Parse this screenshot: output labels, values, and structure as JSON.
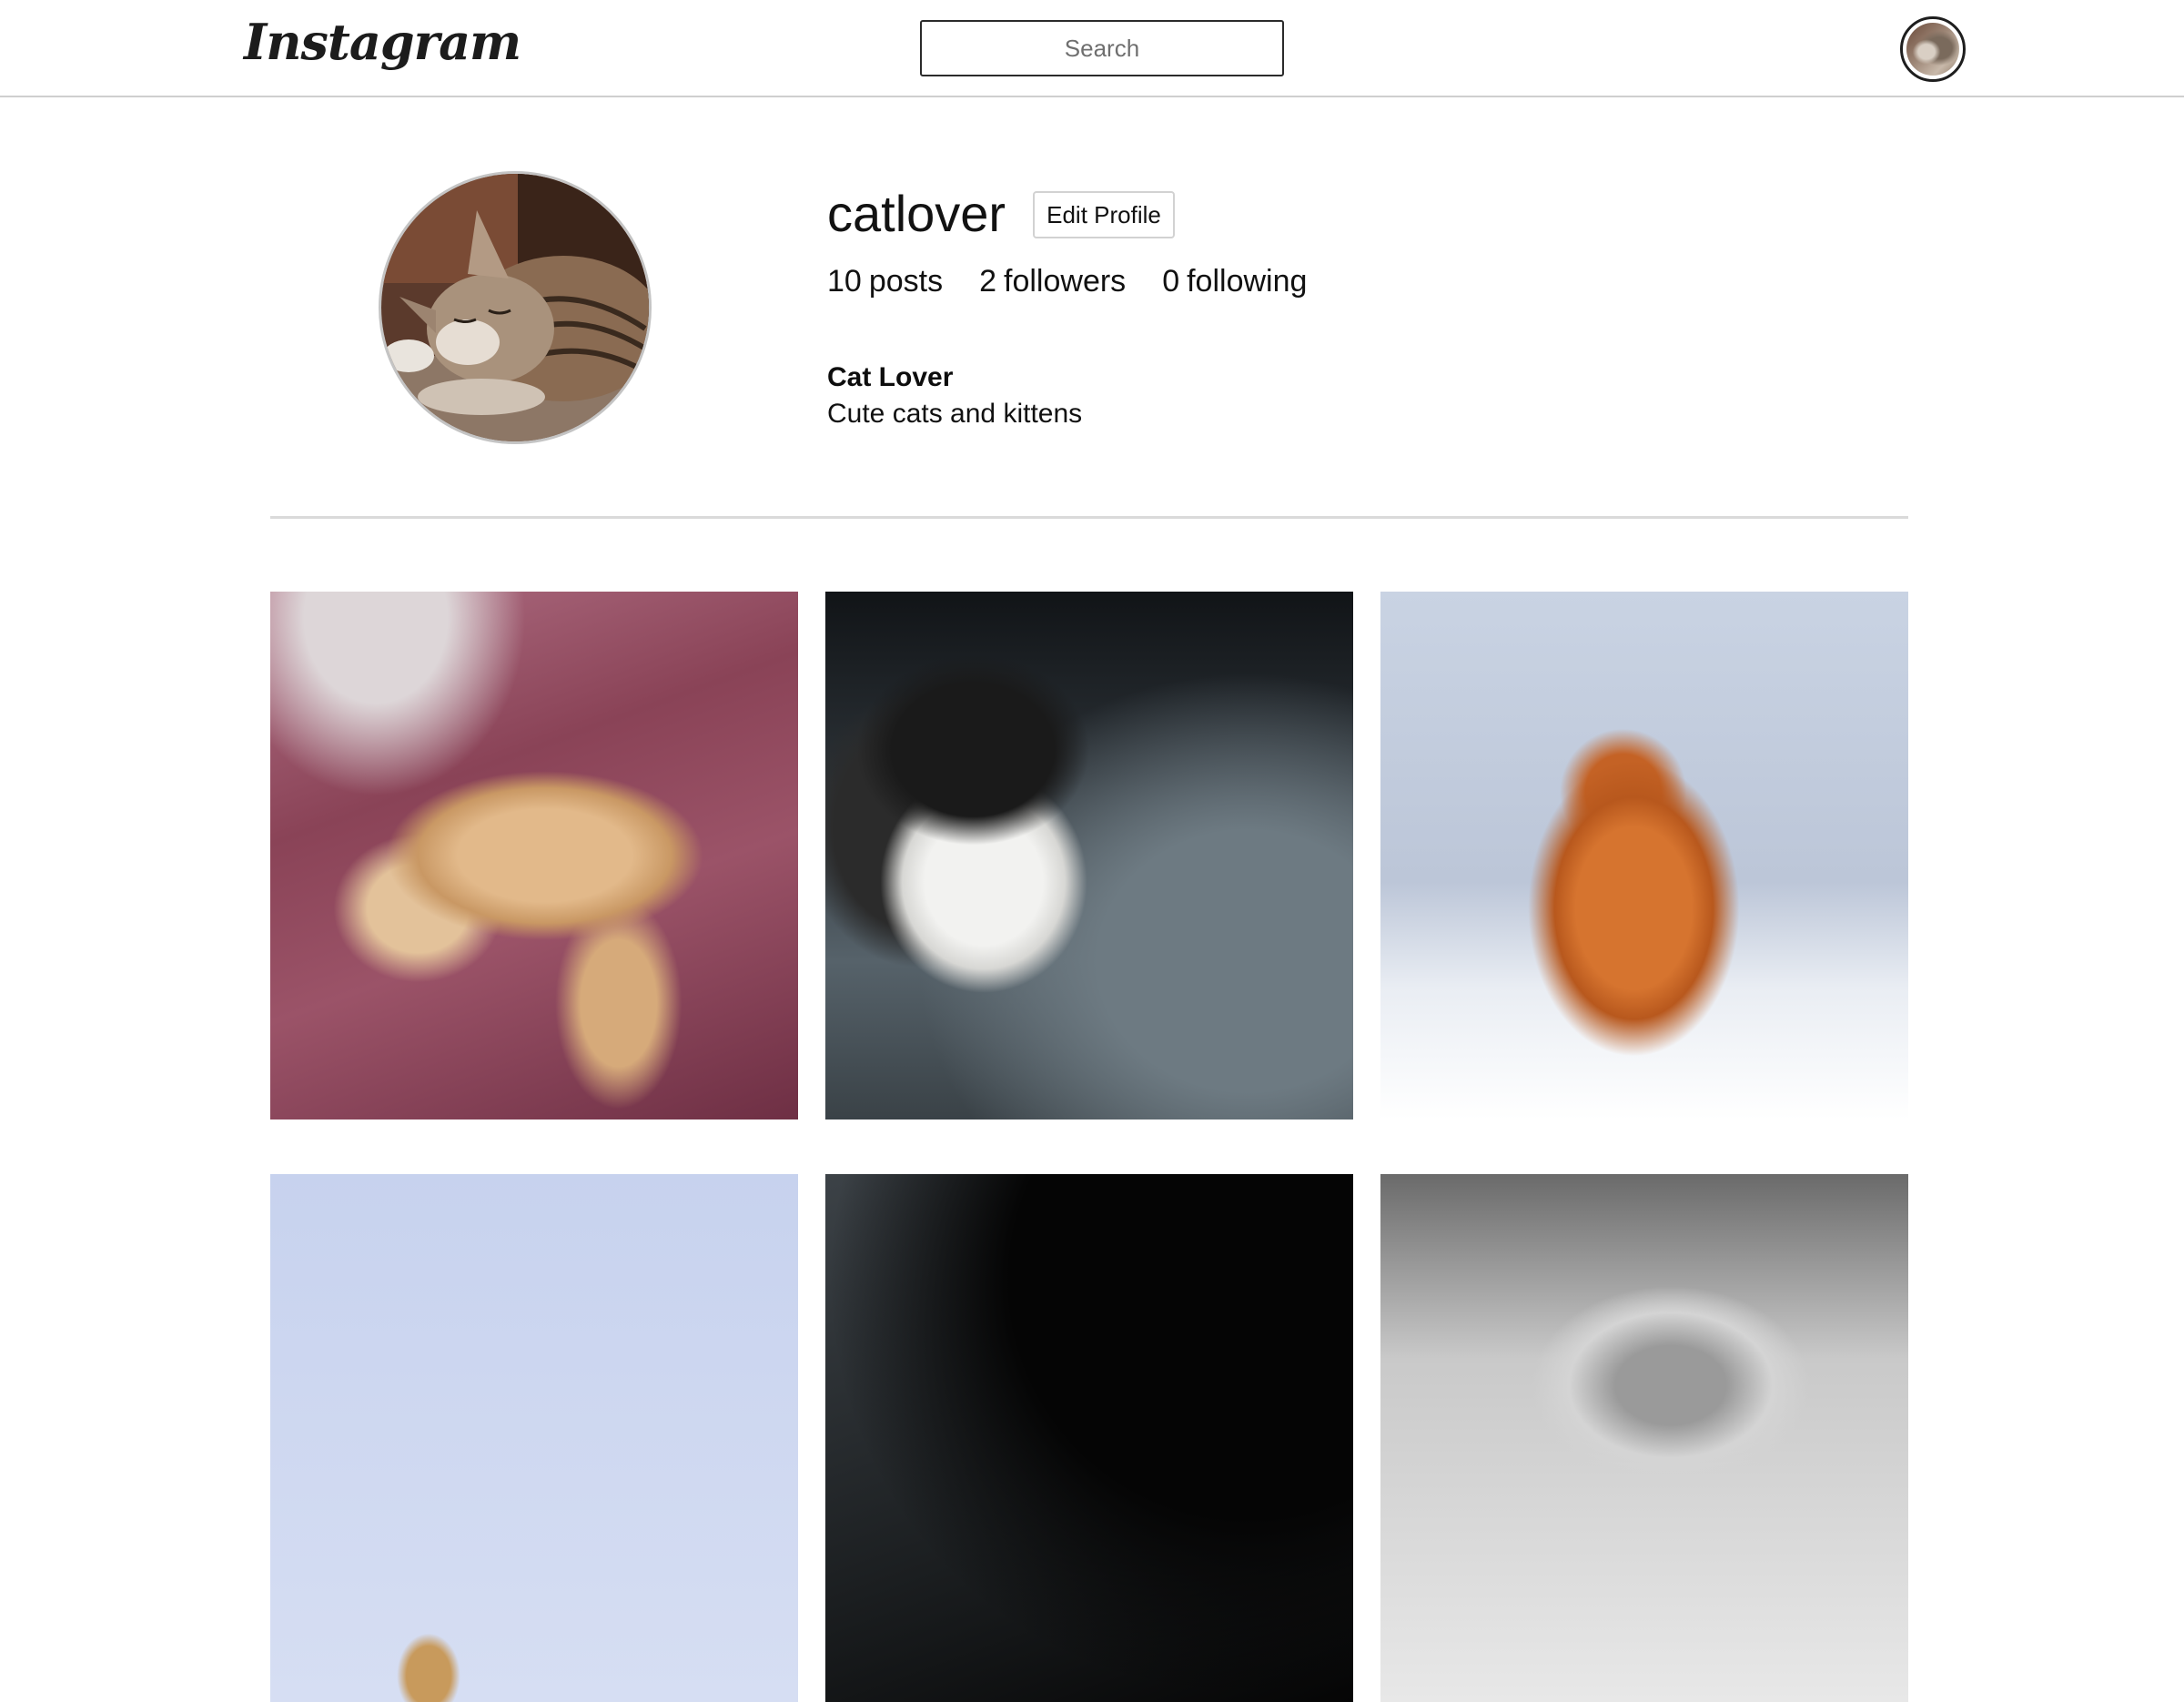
{
  "header": {
    "logo_text": "Instagram",
    "search_placeholder": "Search"
  },
  "profile": {
    "username": "catlover",
    "edit_button_label": "Edit Profile",
    "stats": {
      "posts_count": "10",
      "posts_label": "posts",
      "followers_count": "2",
      "followers_label": "followers",
      "following_count": "0",
      "following_label": "following"
    },
    "full_name": "Cat Lover",
    "bio": "Cute cats and kittens"
  },
  "grid": {
    "posts": [
      {
        "subject": "ginger cat sleeping on pink bedsheet"
      },
      {
        "subject": "black and white kitten looking up"
      },
      {
        "subject": "orange cat covering face with paw"
      },
      {
        "subject": "cat on light blue background"
      },
      {
        "subject": "dark photo"
      },
      {
        "subject": "grey tabby kitten"
      }
    ]
  },
  "icons": {
    "nav_avatar": "profile-avatar-icon"
  }
}
